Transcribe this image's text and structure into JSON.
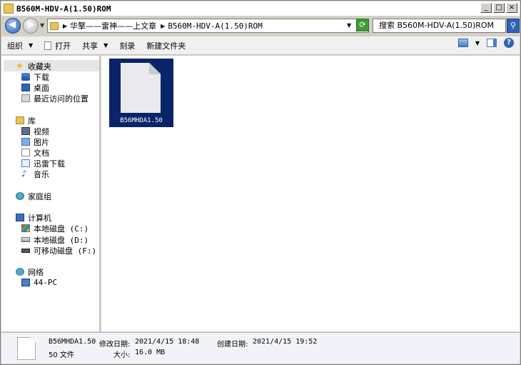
{
  "window": {
    "title": "B560M-HDV-A(1.50)ROM",
    "min_glyph": "_",
    "max_glyph": "□",
    "close_glyph": "×"
  },
  "address": {
    "crumbs": [
      "华擎——雷神——上文章",
      "B560M-HDV-A(1.50)ROM"
    ],
    "search_placeholder": "搜索 B560M-HDV-A(1.50)ROM"
  },
  "toolbar": {
    "organize": "组织",
    "open": "打开",
    "share": "共享",
    "burn": "刻录",
    "new_folder": "新建文件夹"
  },
  "nav": {
    "favorites": {
      "label": "收藏夹",
      "items": [
        "下载",
        "桌面",
        "最近访问的位置"
      ]
    },
    "libraries": {
      "label": "库",
      "items": [
        "视频",
        "图片",
        "文档",
        "迅雷下载",
        "音乐"
      ]
    },
    "homegroup": "家庭组",
    "computer": {
      "label": "计算机",
      "items": [
        "本地磁盘 (C:)",
        "本地磁盘 (D:)",
        "可移动磁盘 (F:)"
      ]
    },
    "network": {
      "label": "网络",
      "items": [
        "44-PC"
      ]
    }
  },
  "files": [
    {
      "name": "B56MHDA1.50",
      "selected": true
    }
  ],
  "details": {
    "name": "B56MHDA1.50",
    "type": "50 文件",
    "modified_label": "修改日期:",
    "modified": "2021/4/15 18:48",
    "created_label": "创建日期:",
    "created": "2021/4/15 19:52",
    "size_label": "大小:",
    "size": "16.0 MB"
  },
  "colors": {
    "selection": "#0a246a",
    "window_bg": "#d4d0c8"
  }
}
